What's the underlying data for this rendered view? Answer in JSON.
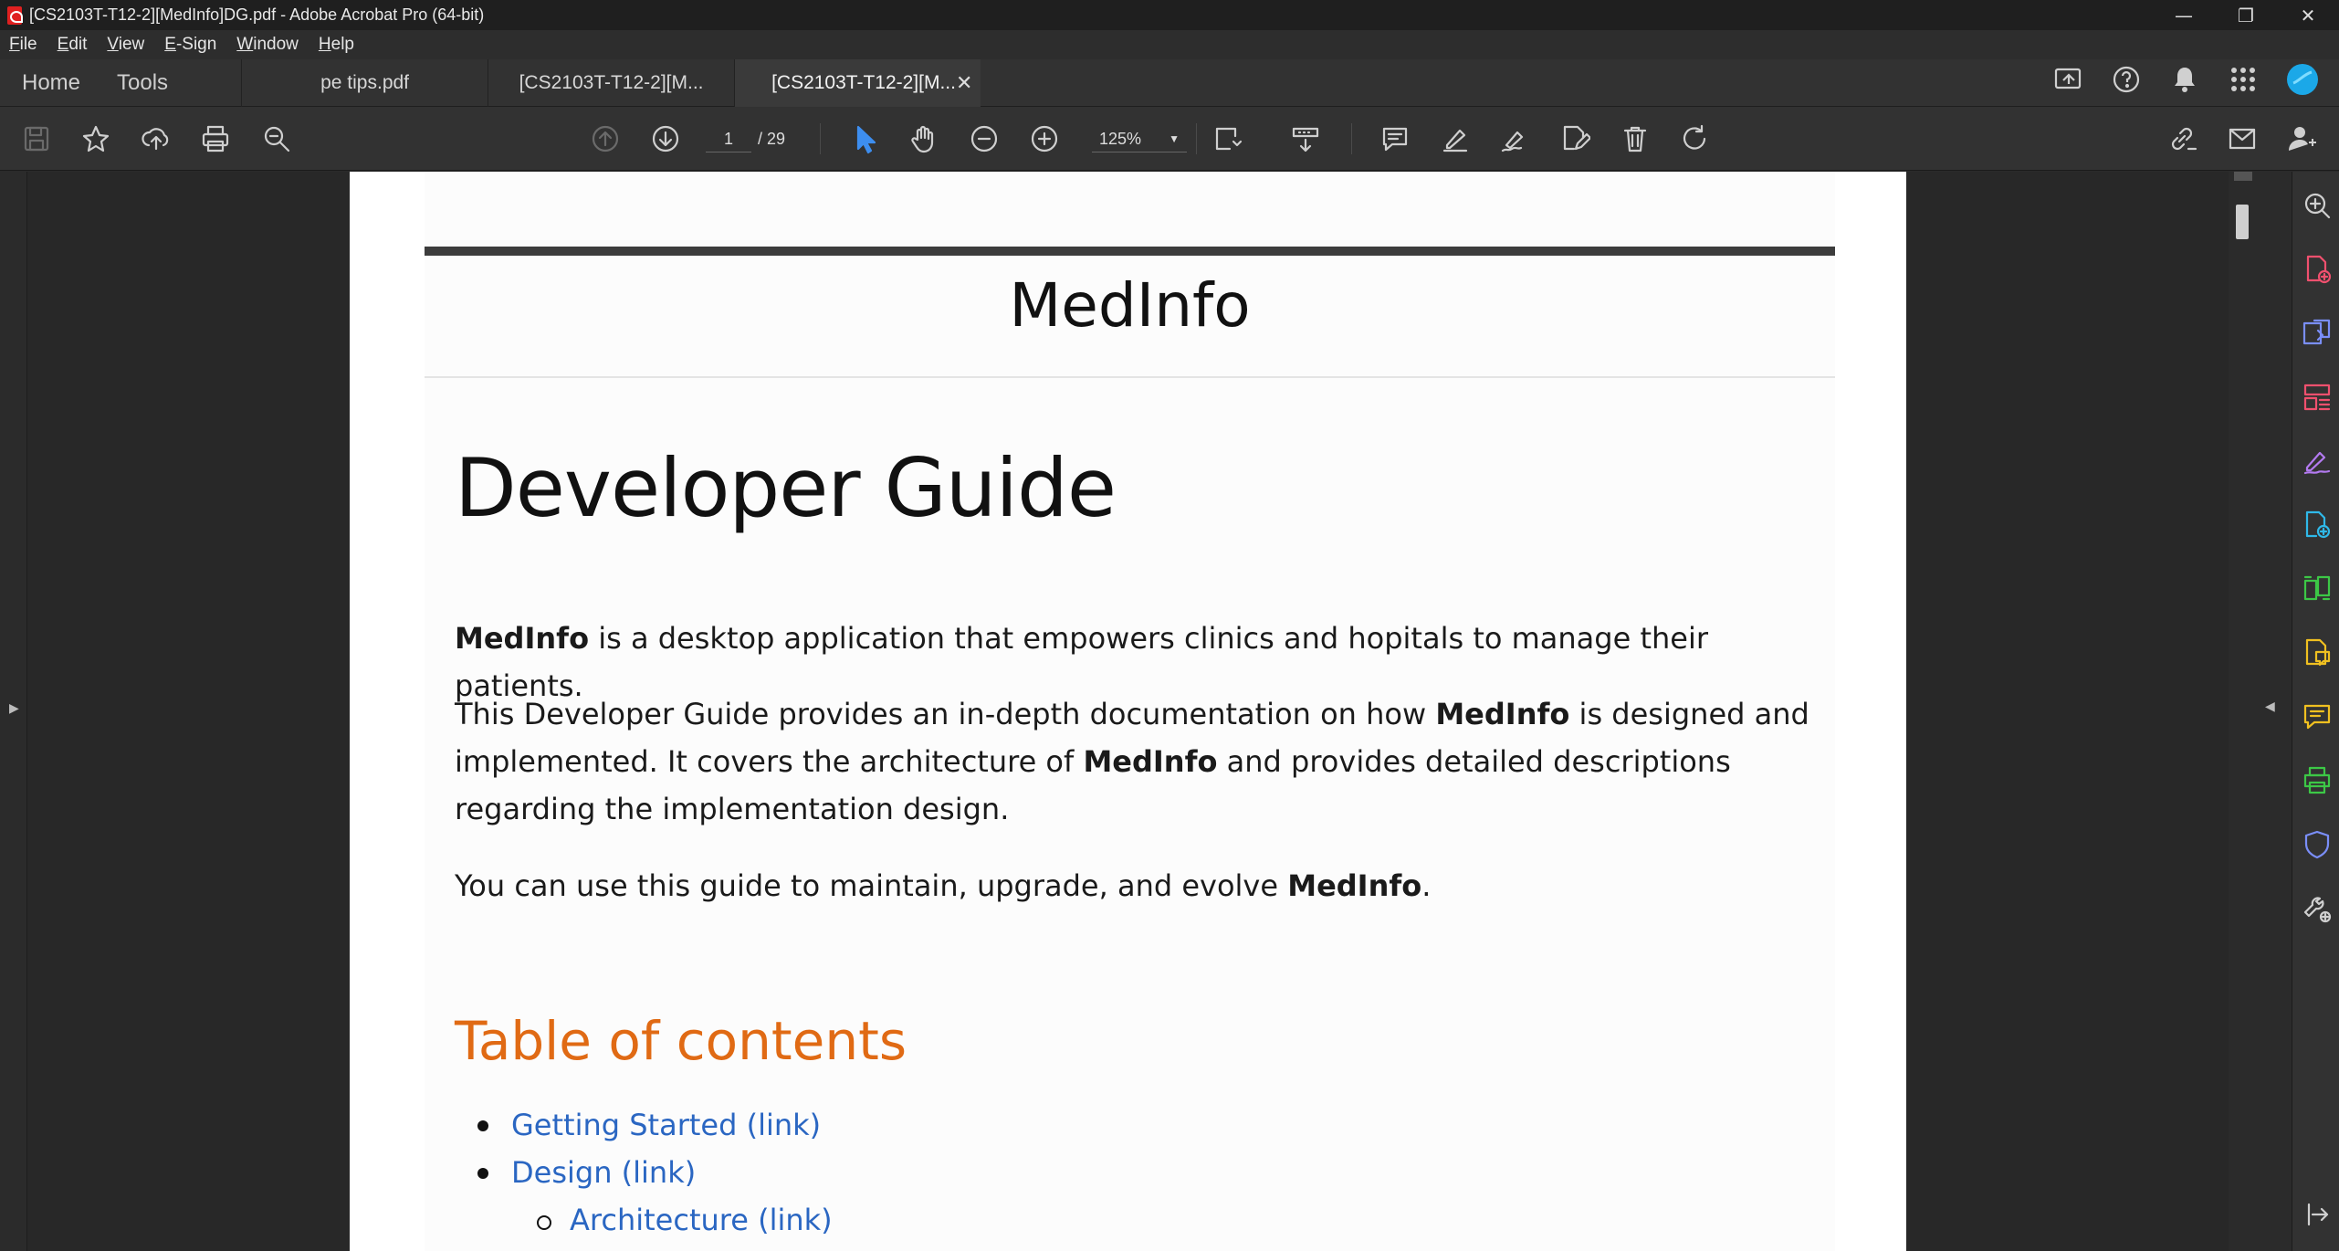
{
  "window": {
    "title": "[CS2103T-T12-2][MedInfo]DG.pdf - Adobe Acrobat Pro (64-bit)"
  },
  "menu": [
    "File",
    "Edit",
    "View",
    "E-Sign",
    "Window",
    "Help"
  ],
  "nav_tabs": {
    "home": "Home",
    "tools": "Tools"
  },
  "doc_tabs": [
    {
      "label": "pe tips.pdf"
    },
    {
      "label": "[CS2103T-T12-2][M..."
    },
    {
      "label": "[CS2103T-T12-2][M..."
    }
  ],
  "toolbar": {
    "current_page": "1",
    "total_pages": "/ 29",
    "zoom": "125%"
  },
  "document": {
    "site_title": "MedInfo",
    "heading": "Developer Guide",
    "intro": {
      "bold": "MedInfo",
      "rest": " is a desktop application that empowers clinics and hopitals to manage their patients."
    },
    "para2": {
      "a": "This Developer Guide provides an in-depth documentation on how ",
      "b1": "MedInfo",
      "c": " is designed and implemented. It covers the architecture of ",
      "b2": "MedInfo",
      "d": " and provides detailed descriptions regarding the implementation design."
    },
    "para3": {
      "a": "You can use this guide to maintain, upgrade, and evolve ",
      "b": "MedInfo",
      "c": "."
    },
    "toc_heading": "Table of contents",
    "toc": [
      {
        "label": "Getting Started (link)"
      },
      {
        "label": "Design (link)"
      },
      {
        "label": "Architecture (link)"
      }
    ]
  },
  "colors": {
    "accent_heading": "#e06a14",
    "link": "#2a66c2",
    "chrome_bg": "#323232"
  }
}
